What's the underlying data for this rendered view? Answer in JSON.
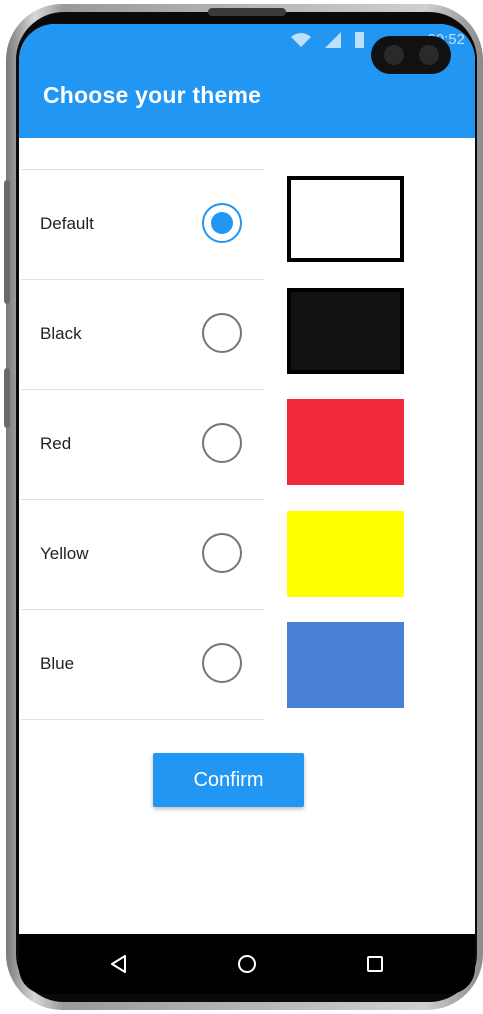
{
  "status_bar": {
    "time": "20:52",
    "icons": [
      "wifi-icon",
      "signal-icon",
      "battery-icon"
    ]
  },
  "appbar": {
    "title": "Choose your theme",
    "color": "#2196f3"
  },
  "themes": [
    {
      "label": "Default",
      "selected": true,
      "swatch_color": "#ffffff",
      "swatch_border": "#000000"
    },
    {
      "label": "Black",
      "selected": false,
      "swatch_color": "#111111",
      "swatch_border": "#000000"
    },
    {
      "label": "Red",
      "selected": false,
      "swatch_color": "#f0283c",
      "swatch_border": ""
    },
    {
      "label": "Yellow",
      "selected": false,
      "swatch_color": "#ffff00",
      "swatch_border": ""
    },
    {
      "label": "Blue",
      "selected": false,
      "swatch_color": "#4a7fd6",
      "swatch_border": ""
    }
  ],
  "confirm_button": {
    "label": "Confirm"
  },
  "nav_bar": {
    "buttons": [
      "back-icon",
      "home-icon",
      "recents-icon"
    ]
  }
}
